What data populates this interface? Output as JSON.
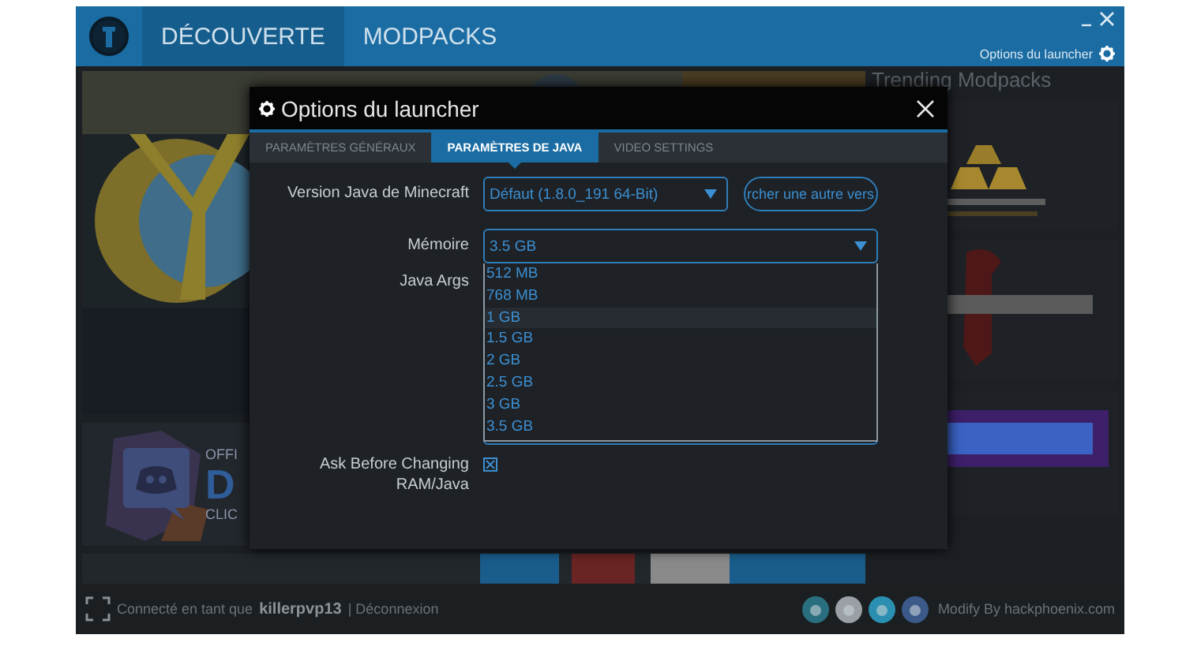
{
  "header": {
    "tabs": [
      {
        "label": "DÉCOUVERTE",
        "selected": true
      },
      {
        "label": "MODPACKS",
        "selected": false
      }
    ],
    "options_link": "Options du launcher"
  },
  "trending": {
    "title": "Trending Modpacks"
  },
  "discord_card": {
    "small_top": "OFFI",
    "big": "D",
    "small_bottom": "CLIC"
  },
  "dialog": {
    "title": "Options du launcher",
    "tabs": [
      {
        "label": "PARAMÈTRES GÉNÉRAUX",
        "selected": false
      },
      {
        "label": "PARAMÈTRES DE JAVA",
        "selected": true
      },
      {
        "label": "VIDEO SETTINGS",
        "selected": false
      }
    ],
    "java_version": {
      "label": "Version Java de Minecraft",
      "value": "Défaut (1.8.0_191 64-Bit)",
      "button": "rcher une autre vers"
    },
    "memory": {
      "label": "Mémoire",
      "value": "3.5 GB",
      "expanded": true,
      "options": [
        {
          "label": "512 MB",
          "highlighted": false
        },
        {
          "label": "768 MB",
          "highlighted": false
        },
        {
          "label": "1 GB",
          "highlighted": true
        },
        {
          "label": "1.5 GB",
          "highlighted": false
        },
        {
          "label": "2 GB",
          "highlighted": false
        },
        {
          "label": "2.5 GB",
          "highlighted": false
        },
        {
          "label": "3 GB",
          "highlighted": false
        },
        {
          "label": "3.5 GB",
          "highlighted": false
        }
      ]
    },
    "java_args": {
      "label": "Java Args"
    },
    "ask_before": {
      "label": "Ask Before Changing RAM/Java",
      "checked": true
    }
  },
  "footer": {
    "connected_prefix": "Connecté en tant que",
    "username": "killerpvp13",
    "logout": "| Déconnexion",
    "credit": "Modify By hackphoenix.com"
  }
}
